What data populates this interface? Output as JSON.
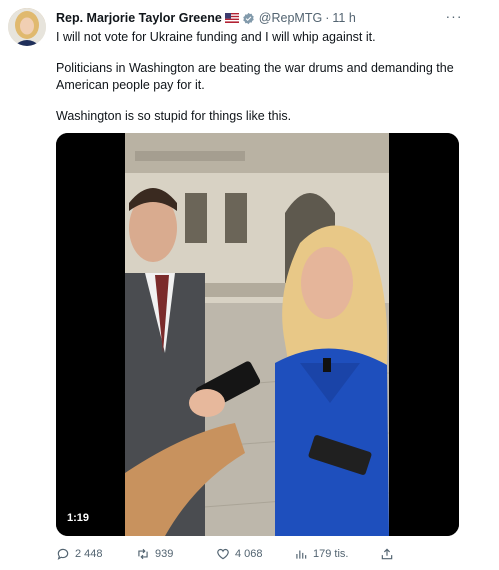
{
  "tweet": {
    "author_name": "Rep. Marjorie Taylor Greene",
    "handle": "@RepMTG",
    "time": "11 h",
    "separator": "·",
    "more_glyph": "···",
    "text": [
      "I will not vote for Ukraine funding and I will whip against it.",
      "Politicians in Washington are beating the war drums and demanding the American people pay for it.",
      "Washington is so stupid for things like this."
    ],
    "video_duration": "1:19",
    "stats": {
      "replies": "2 448",
      "retweets": "939",
      "likes": "4 068",
      "views": "179 tis."
    }
  },
  "icons": {
    "flag": "us-flag-icon",
    "verified": "verified-badge-icon",
    "reply": "reply-icon",
    "retweet": "retweet-icon",
    "like": "heart-icon",
    "views": "views-icon",
    "share": "share-icon"
  },
  "colors": {
    "text": "#0f1419",
    "muted": "#536471",
    "verified": "#829aab",
    "video_bg": "#000000"
  }
}
